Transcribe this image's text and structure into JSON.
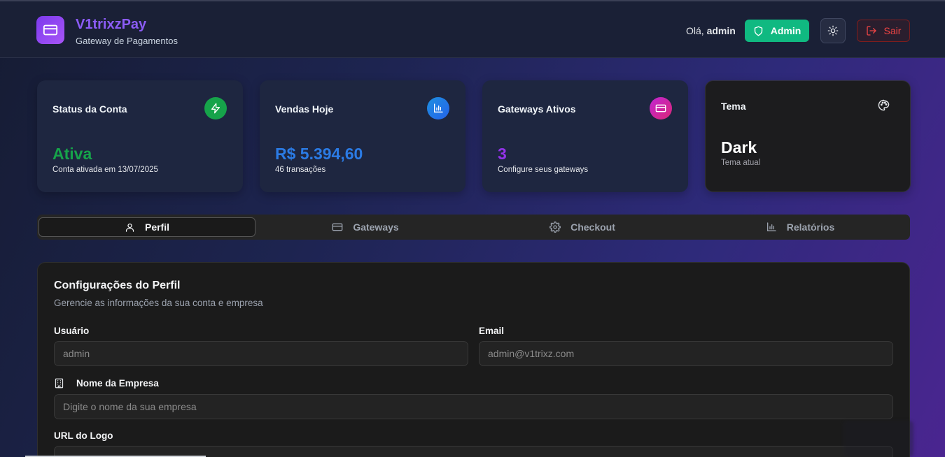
{
  "header": {
    "brand_name": "V1trixzPay",
    "brand_subtitle": "Gateway de Pagamentos",
    "greeting_prefix": "Olá,",
    "greeting_user": "admin",
    "admin_label": "Admin",
    "logout_label": "Sair"
  },
  "cards": [
    {
      "title": "Status da Conta",
      "value": "Ativa",
      "sub": "Conta ativada em 13/07/2025",
      "icon": "zap-icon",
      "icon_color": "#16a34a",
      "value_color": "#16a34a"
    },
    {
      "title": "Vendas Hoje",
      "value": "R$ 5.394,60",
      "sub": "46 transações",
      "icon": "bar-chart-icon",
      "icon_color": "#1d8fe0",
      "value_color": "#2b7be5"
    },
    {
      "title": "Gateways Ativos",
      "value": "3",
      "sub": "Configure seus gateways",
      "icon": "credit-card-icon",
      "icon_color": "#c026d3",
      "value_color": "#9333ea"
    },
    {
      "title": "Tema",
      "value": "Dark",
      "sub": "Tema atual",
      "icon": "palette-icon",
      "value_color": "#ffffff"
    }
  ],
  "tabs": [
    {
      "label": "Perfil",
      "icon": "user-icon",
      "active": true
    },
    {
      "label": "Gateways",
      "icon": "credit-card-icon",
      "active": false
    },
    {
      "label": "Checkout",
      "icon": "gear-icon",
      "active": false
    },
    {
      "label": "Relatórios",
      "icon": "bar-chart-icon",
      "active": false
    }
  ],
  "profile": {
    "title": "Configurações do Perfil",
    "subtitle": "Gerencie as informações da sua conta e empresa",
    "username_label": "Usuário",
    "username_value": "admin",
    "email_label": "Email",
    "email_value": "admin@v1trixz.com",
    "company_label": "Nome da Empresa",
    "company_placeholder": "Digite o nome da sua empresa",
    "logo_url_label": "URL do Logo"
  },
  "colors": {
    "accent": "#8b5cf6",
    "admin_green": "#10b981",
    "logout_red": "#ef4444"
  }
}
